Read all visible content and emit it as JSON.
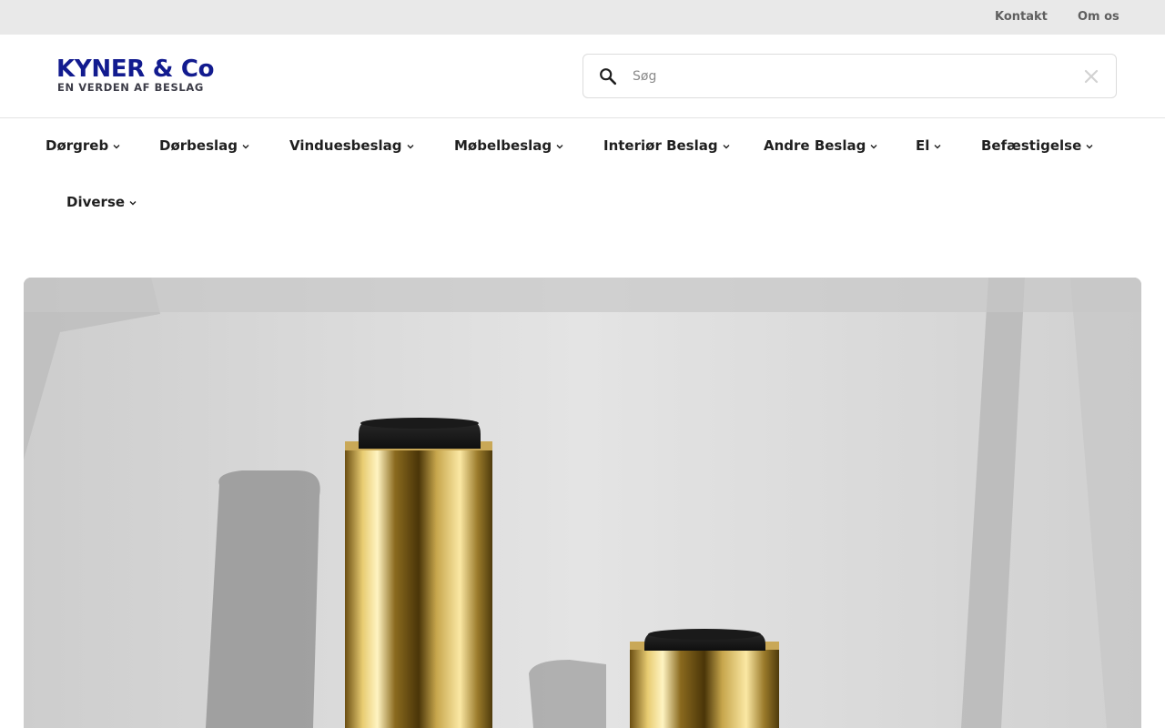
{
  "topbar": {
    "links": [
      "Kontakt",
      "Om os"
    ]
  },
  "logo": {
    "line1": "KYNER & Co",
    "line2": "EN VERDEN AF BESLAG",
    "color_primary": "#121b8f",
    "color_secondary": "#3d3d48"
  },
  "search": {
    "placeholder": "Søg",
    "value": "",
    "search_icon": "search-icon",
    "clear_icon": "close-icon"
  },
  "nav": {
    "items": [
      {
        "label": "Dørgreb",
        "icon": "chevron-down-icon"
      },
      {
        "label": "Dørbeslag",
        "icon": "chevron-down-icon"
      },
      {
        "label": "Vinduesbeslag",
        "icon": "chevron-down-icon"
      },
      {
        "label": "Møbelbeslag",
        "icon": "chevron-down-icon"
      },
      {
        "label": "Interiør Beslag",
        "icon": "chevron-down-icon"
      },
      {
        "label": "Andre Beslag",
        "icon": "chevron-down-icon"
      },
      {
        "label": "El",
        "icon": "chevron-down-icon"
      },
      {
        "label": "Befæstigelse",
        "icon": "chevron-down-icon"
      },
      {
        "label": "Diverse",
        "icon": "chevron-down-icon"
      }
    ]
  },
  "hero": {
    "image": "hero-product-image"
  },
  "colors": {
    "topbar_bg": "#e9e9e9",
    "text": "#1f1f1f",
    "muted": "#5f5f5f",
    "brass": "#b8952f"
  }
}
